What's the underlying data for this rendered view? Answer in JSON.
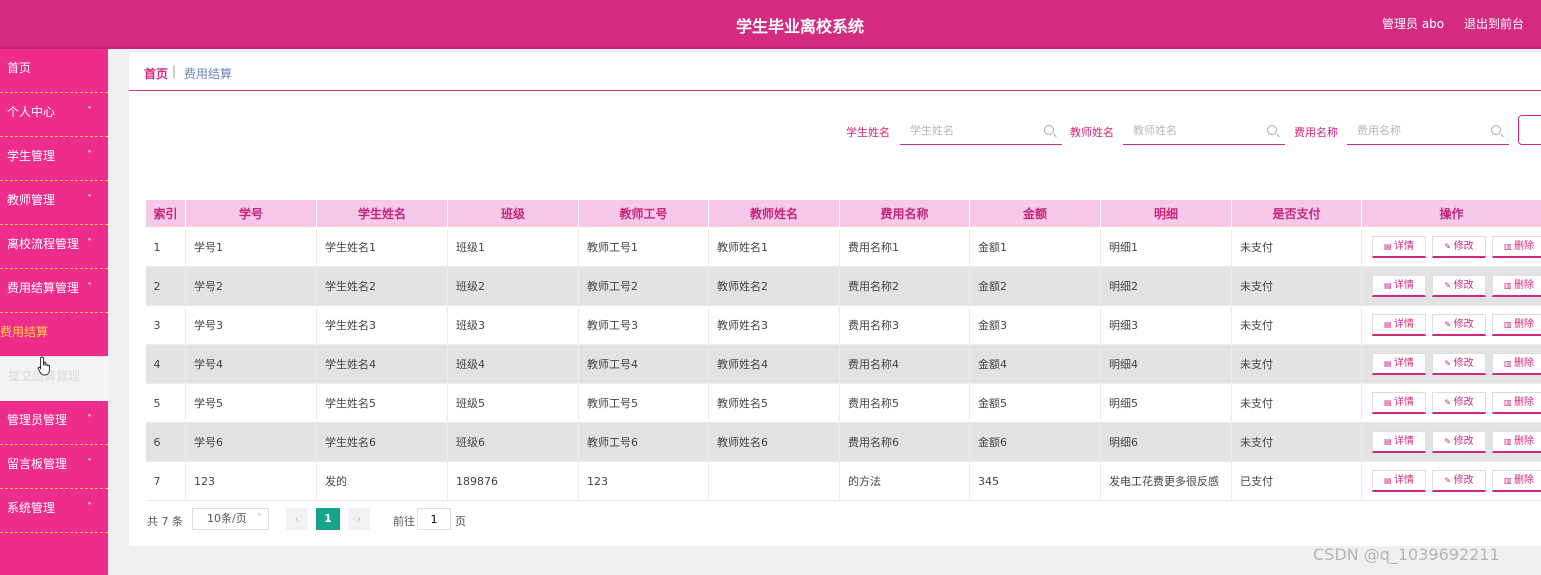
{
  "header": {
    "title": "学生毕业离校系统",
    "admin_label": "管理员 abo",
    "exit_label": "退出到前台"
  },
  "sidebar": {
    "items": [
      {
        "label": "首页",
        "chevron": ""
      },
      {
        "label": "个人中心",
        "chevron": "˅"
      },
      {
        "label": "学生管理",
        "chevron": "˅"
      },
      {
        "label": "教师管理",
        "chevron": "˅"
      },
      {
        "label": "离校流程管理",
        "chevron": "˅"
      },
      {
        "label": "费用结算管理",
        "chevron": "˄"
      },
      {
        "label": "管理员管理",
        "chevron": "˅"
      },
      {
        "label": "留言板管理",
        "chevron": "˅"
      },
      {
        "label": "系统管理",
        "chevron": "˅"
      }
    ],
    "sub_items": [
      {
        "label": "费用结算",
        "state": "active"
      },
      {
        "label": "提交结算管理",
        "state": "hover"
      }
    ]
  },
  "breadcrumb": {
    "home": "首页",
    "separator": "|",
    "current": "费用结算"
  },
  "search": {
    "student_name_label": "学生姓名",
    "student_name_placeholder": "学生姓名",
    "teacher_name_label": "教师姓名",
    "teacher_name_placeholder": "教师姓名",
    "fee_name_label": "费用名称",
    "fee_name_placeholder": "费用名称"
  },
  "table": {
    "columns": [
      "索引",
      "学号",
      "学生姓名",
      "班级",
      "教师工号",
      "教师姓名",
      "费用名称",
      "金额",
      "明细",
      "是否支付",
      "操作"
    ],
    "rows": [
      [
        "1",
        "学号1",
        "学生姓名1",
        "班级1",
        "教师工号1",
        "教师姓名1",
        "费用名称1",
        "金额1",
        "明细1",
        "未支付"
      ],
      [
        "2",
        "学号2",
        "学生姓名2",
        "班级2",
        "教师工号2",
        "教师姓名2",
        "费用名称2",
        "金额2",
        "明细2",
        "未支付"
      ],
      [
        "3",
        "学号3",
        "学生姓名3",
        "班级3",
        "教师工号3",
        "教师姓名3",
        "费用名称3",
        "金额3",
        "明细3",
        "未支付"
      ],
      [
        "4",
        "学号4",
        "学生姓名4",
        "班级4",
        "教师工号4",
        "教师姓名4",
        "费用名称4",
        "金额4",
        "明细4",
        "未支付"
      ],
      [
        "5",
        "学号5",
        "学生姓名5",
        "班级5",
        "教师工号5",
        "教师姓名5",
        "费用名称5",
        "金额5",
        "明细5",
        "未支付"
      ],
      [
        "6",
        "学号6",
        "学生姓名6",
        "班级6",
        "教师工号6",
        "教师姓名6",
        "费用名称6",
        "金额6",
        "明细6",
        "未支付"
      ],
      [
        "7",
        "123",
        "发的",
        "189876",
        "123",
        "",
        "的方法",
        "345",
        "发电工花费更多很反感",
        "已支付"
      ]
    ],
    "actions": {
      "detail": "详情",
      "edit": "修改",
      "delete": "删除"
    }
  },
  "pagination": {
    "total_text": "共 7 条",
    "page_size": "10条/页",
    "prev": "‹",
    "current_page": "1",
    "next": "›",
    "goto_label": "前往",
    "goto_value": "1",
    "goto_unit": "页"
  },
  "watermark": "CSDN @q_1039692211",
  "colors": {
    "primary": "#d42b80",
    "sidebar": "#ee2c8c",
    "table_header": "#f8c8e9",
    "active_page": "#14a58a"
  }
}
